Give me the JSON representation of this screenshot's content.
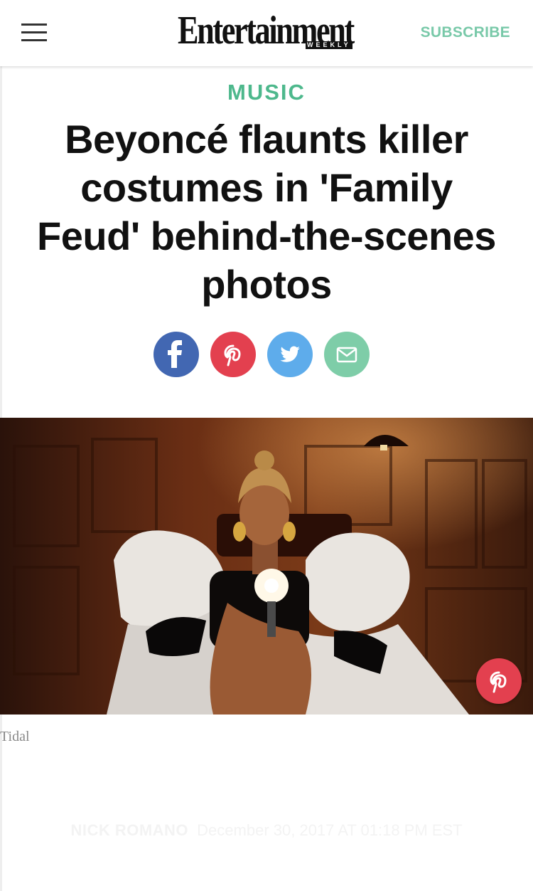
{
  "header": {
    "logo_text": "Entertainment",
    "logo_subtext": "WEEKLY",
    "subscribe_label": "SUBSCRIBE",
    "menu_icon": "hamburger-menu-icon"
  },
  "article": {
    "category": "MUSIC",
    "headline": "Beyoncé flaunts killer costumes in 'Family Feud' behind-the-scenes photos",
    "share_buttons": [
      {
        "network": "facebook",
        "icon": "facebook-icon",
        "color": "#4267b2"
      },
      {
        "network": "pinterest",
        "icon": "pinterest-icon",
        "color": "#e3404f"
      },
      {
        "network": "twitter",
        "icon": "twitter-icon",
        "color": "#5eaceb"
      },
      {
        "network": "email",
        "icon": "email-icon",
        "color": "#7ecda8"
      }
    ],
    "image_caption": "Tidal",
    "author": "NICK ROMANO",
    "date": "December 30, 2017 AT 01:18 PM EST"
  },
  "colors": {
    "accent_green": "#4db88c",
    "subscribe_green": "#79c9a9",
    "headline": "#111111"
  }
}
